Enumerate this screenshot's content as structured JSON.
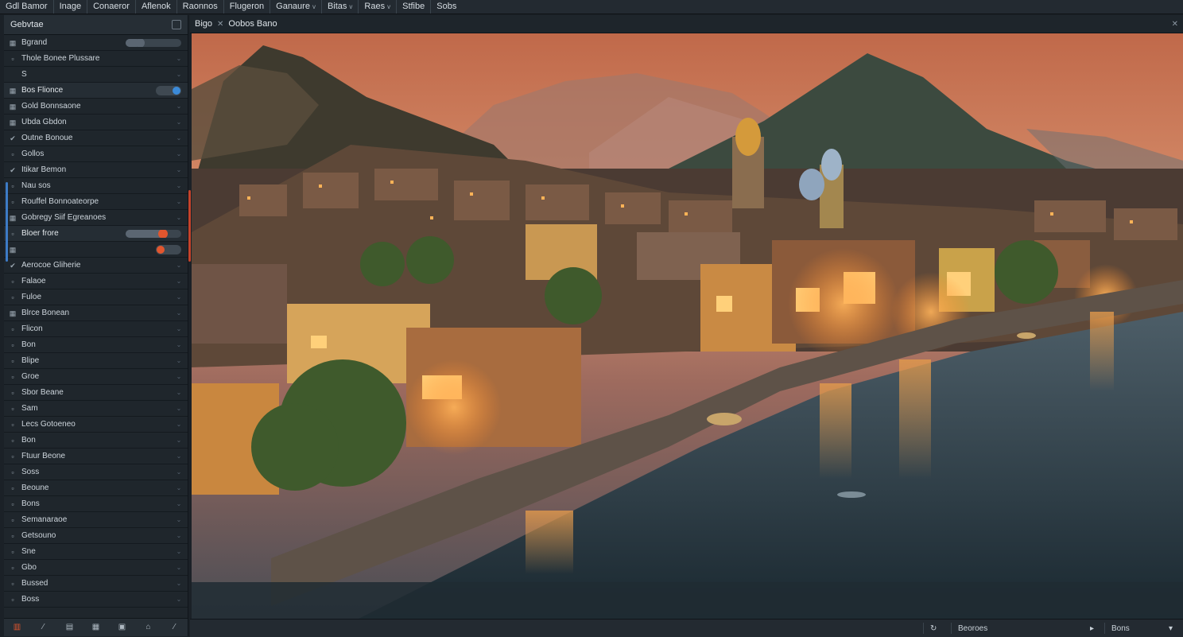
{
  "menu": {
    "items": [
      {
        "label": "Gdl Bamor",
        "chev": ""
      },
      {
        "label": "Inage",
        "chev": ""
      },
      {
        "label": "Conaeror",
        "chev": ""
      },
      {
        "label": "Aflenok",
        "chev": ""
      },
      {
        "label": "Raonnos",
        "chev": ""
      },
      {
        "label": "Flugeron",
        "chev": ""
      },
      {
        "label": "Ganaure",
        "chev": "v"
      },
      {
        "label": "Bitas",
        "chev": "v"
      },
      {
        "label": "Raes",
        "chev": "v"
      },
      {
        "label": "Stfibe",
        "chev": ""
      },
      {
        "label": "Sobs",
        "chev": ""
      }
    ]
  },
  "panel": {
    "title": "Gebvtae",
    "rows": [
      {
        "label": "Bgrand",
        "icon": "▦",
        "type": "slider",
        "value": 0.2
      },
      {
        "label": "Thole Bonee Plussare",
        "icon": "▫",
        "type": "chev"
      },
      {
        "label": "S",
        "icon": "",
        "type": "toggle"
      },
      {
        "label": "Bos Flionce",
        "icon": "▦",
        "type": "toggle-blue",
        "section": true
      },
      {
        "label": "Gold Bonnsaone",
        "icon": "▦",
        "type": "chev"
      },
      {
        "label": "Ubda Gbdon",
        "icon": "▦",
        "type": "chev"
      },
      {
        "label": "Outne Bonoue",
        "icon": "✔",
        "type": "chev"
      },
      {
        "label": "Gollos",
        "icon": "▫",
        "type": "chev"
      },
      {
        "label": "Itikar Bemon",
        "icon": "✔",
        "type": "chev"
      },
      {
        "label": "Nau sos",
        "icon": "▫",
        "type": "chev"
      },
      {
        "label": "Rouffel Bonnoateorpe",
        "icon": "▫",
        "type": "chev"
      },
      {
        "label": "Gobregy Siif Egreanoes",
        "icon": "▦",
        "type": "chev"
      },
      {
        "label": "Bloer frore",
        "icon": "▫",
        "type": "slider-orange",
        "value": 0.7,
        "section": true
      },
      {
        "label": "",
        "icon": "▦",
        "type": "toggle-orange"
      },
      {
        "label": "Aerocoe Gliherie",
        "icon": "✔",
        "type": "chev"
      },
      {
        "label": "Falaoe",
        "icon": "▫",
        "type": "chev"
      },
      {
        "label": "Fuloe",
        "icon": "▫",
        "type": "chev"
      },
      {
        "label": "Blrce Bonean",
        "icon": "▦",
        "type": "chev"
      },
      {
        "label": "Flicon",
        "icon": "▫",
        "type": "chev"
      },
      {
        "label": "Bon",
        "icon": "▫",
        "type": "chev"
      },
      {
        "label": "Blipe",
        "icon": "▫",
        "type": "chev"
      },
      {
        "label": "Groe",
        "icon": "▫",
        "type": "chev"
      },
      {
        "label": "Sbor Beane",
        "icon": "▫",
        "type": "chev"
      },
      {
        "label": "Sam",
        "icon": "▫",
        "type": "chev"
      },
      {
        "label": "Lecs Gotoeneo",
        "icon": "▫",
        "type": "chev"
      },
      {
        "label": "Bon",
        "icon": "▫",
        "type": "chev"
      },
      {
        "label": "Ftuur Beone",
        "icon": "▫",
        "type": "chev"
      },
      {
        "label": "Soss",
        "icon": "▫",
        "type": "chev"
      },
      {
        "label": "Beoune",
        "icon": "▫",
        "type": "chev"
      },
      {
        "label": "Bons",
        "icon": "▫",
        "type": "chev"
      },
      {
        "label": "Semanaraoe",
        "icon": "▫",
        "type": "chev"
      },
      {
        "label": "Getsouno",
        "icon": "▫",
        "type": "chev"
      },
      {
        "label": "Sne",
        "icon": "▫",
        "type": "chev"
      },
      {
        "label": "Gbo",
        "icon": "▫",
        "type": "chev"
      },
      {
        "label": "Bussed",
        "icon": "▫",
        "type": "chev"
      },
      {
        "label": "Boss",
        "icon": "▫",
        "type": "chev"
      }
    ],
    "footer": [
      "▥",
      "⁄",
      "▤",
      "▦",
      "▣",
      "⌂",
      "⁄"
    ]
  },
  "doc": {
    "tab_label": "Bigo",
    "title": "Oobos Bano",
    "corner": "✕"
  },
  "statusbar": {
    "item1": "Beoroes",
    "item2": "Bons"
  },
  "colors": {
    "accent_orange": "#e2562e",
    "accent_blue": "#3b8ad8",
    "panel_bg": "#1f262c"
  }
}
